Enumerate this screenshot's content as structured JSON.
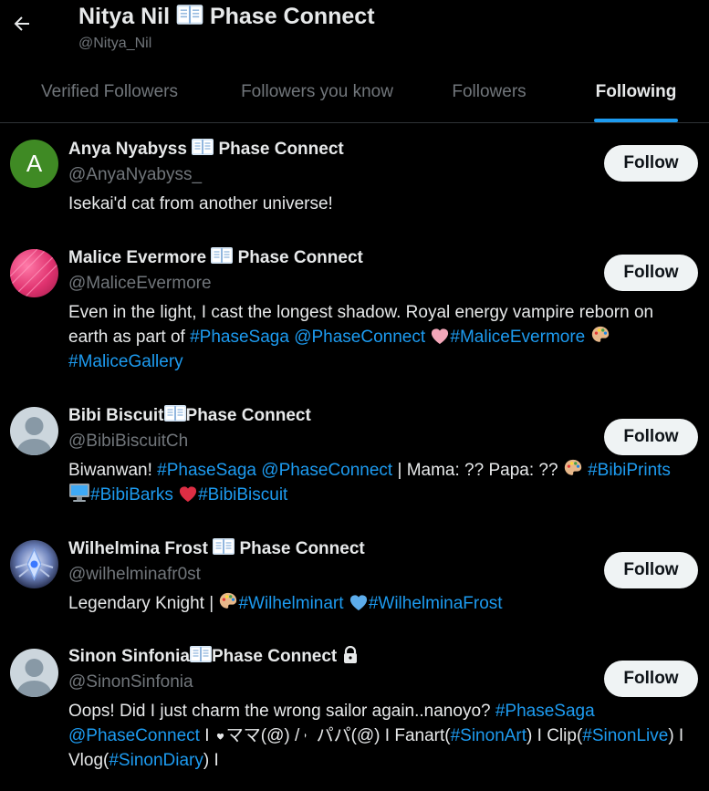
{
  "header": {
    "title_name": "Nitya Nil",
    "title_suffix": "Phase Connect",
    "handle": "@Nitya_Nil"
  },
  "tabs": [
    {
      "label": "Verified Followers",
      "active": false
    },
    {
      "label": "Followers you know",
      "active": false
    },
    {
      "label": "Followers",
      "active": false
    },
    {
      "label": "Following",
      "active": true
    }
  ],
  "users": [
    {
      "name": "Anya Nyabyss",
      "suffix": "Phase Connect",
      "handle": "@AnyaNyabyss_",
      "follow_label": "Follow",
      "avatar_letter": "A",
      "bio": [
        "Isekai'd cat from another universe!"
      ]
    },
    {
      "name": "Malice Evermore",
      "suffix": "Phase Connect",
      "handle": "@MaliceEvermore",
      "follow_label": "Follow",
      "bio_parts": {
        "t1": "Even in the light, I cast the longest shadow. Royal energy vampire reborn on earth as part of ",
        "l1": "#PhaseSaga",
        "l2": "@PhaseConnect",
        "l3": "#MaliceEvermore",
        "l4": "#MaliceGallery"
      }
    },
    {
      "name": "Bibi Biscuit",
      "suffix": "Phase Connect",
      "handle": "@BibiBiscuitCh",
      "follow_label": "Follow",
      "bio_parts": {
        "t1": "Biwanwan! ",
        "l1": "#PhaseSaga",
        "l2": "@PhaseConnect",
        "t2": " | Mama: ?? Papa: ?? ",
        "l3": "#BibiPrints",
        "l4": "#BibiBarks",
        "l5": "#BibiBiscuit"
      }
    },
    {
      "name": "Wilhelmina Frost",
      "suffix": "Phase Connect",
      "handle": "@wilhelminafr0st",
      "follow_label": "Follow",
      "bio_parts": {
        "t1": "Legendary Knight | ",
        "l1": "#Wilhelminart",
        "l2": "#WilhelminaFrost"
      }
    },
    {
      "name": "Sinon Sinfonia",
      "suffix": "Phase Connect",
      "handle": "@SinonSinfonia",
      "follow_label": "Follow",
      "bio_parts": {
        "t1": "Oops! Did I just charm the wrong sailor again..nanoyo? ",
        "l1": "#PhaseSaga",
        "l2": "@PhaseConnect",
        "t2": " I ",
        "t3": "ママ(@) / ",
        "t4": "パパ(@) I Fanart(",
        "l3": "#SinonArt",
        "t5": ") I Clip(",
        "l4": "#SinonLive",
        "t6": ") I Vlog(",
        "l5": "#SinonDiary",
        "t7": ") I"
      }
    }
  ],
  "colors": {
    "background": "#000000",
    "accent": "#1d9bf0",
    "muted": "#71767b",
    "text": "#e7e9ea"
  },
  "icons": [
    "back-arrow-icon",
    "open-book-icon",
    "lock-icon",
    "heart-icon",
    "palette-icon",
    "computer-icon"
  ]
}
